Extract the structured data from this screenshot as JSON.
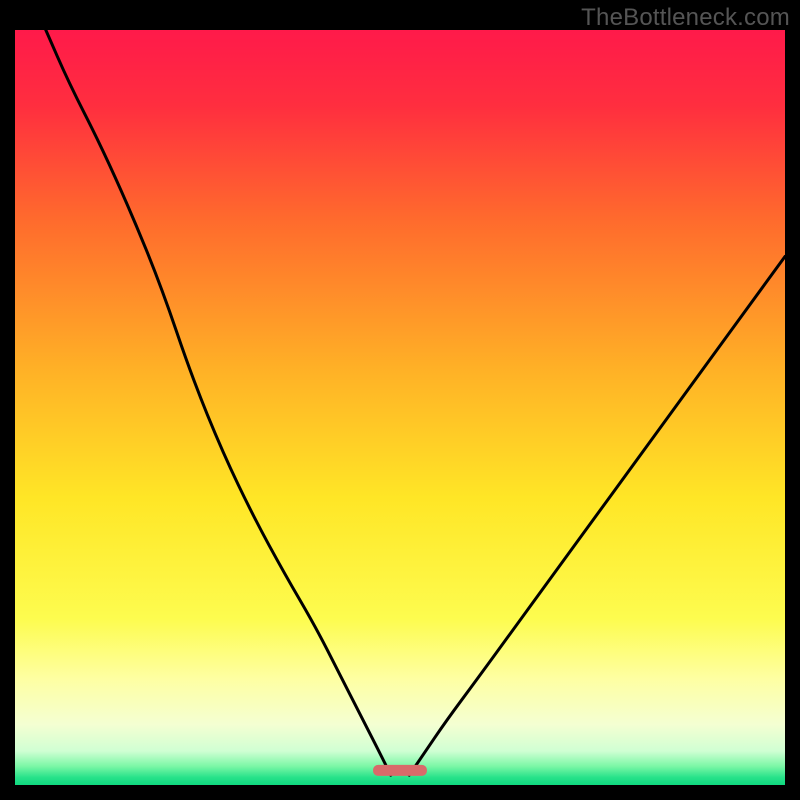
{
  "watermark": "TheBottleneck.com",
  "chart_data": {
    "type": "line",
    "title": "",
    "xlabel": "",
    "ylabel": "",
    "xlim": [
      0,
      100
    ],
    "ylim": [
      0,
      100
    ],
    "background_gradient": {
      "stops": [
        {
          "offset": 0.0,
          "color": "#ff1a4a"
        },
        {
          "offset": 0.1,
          "color": "#ff2e3f"
        },
        {
          "offset": 0.25,
          "color": "#ff6a2d"
        },
        {
          "offset": 0.45,
          "color": "#ffb126"
        },
        {
          "offset": 0.62,
          "color": "#ffe626"
        },
        {
          "offset": 0.78,
          "color": "#fdfc4f"
        },
        {
          "offset": 0.86,
          "color": "#feffa3"
        },
        {
          "offset": 0.92,
          "color": "#f4ffd2"
        },
        {
          "offset": 0.955,
          "color": "#d0ffd3"
        },
        {
          "offset": 0.975,
          "color": "#7cf7a6"
        },
        {
          "offset": 0.99,
          "color": "#27e28a"
        },
        {
          "offset": 1.0,
          "color": "#0fd87f"
        }
      ]
    },
    "marker": {
      "x_center": 50,
      "width": 7,
      "y": 2,
      "color": "#d86a6a"
    },
    "series": [
      {
        "name": "left-curve",
        "x": [
          4.0,
          7,
          11,
          15,
          19,
          23,
          27,
          31,
          35,
          39,
          42,
          45,
          47.5,
          48.8
        ],
        "values": [
          100,
          93,
          85,
          76,
          66,
          54,
          44,
          35.5,
          28,
          21,
          15,
          9,
          4,
          1.3
        ]
      },
      {
        "name": "right-curve",
        "x": [
          51.2,
          53,
          56,
          60,
          65,
          70,
          75,
          80,
          85,
          90,
          95,
          100
        ],
        "values": [
          1.3,
          4,
          8.5,
          14,
          21,
          28,
          35,
          42,
          49,
          56,
          63,
          70
        ]
      }
    ]
  }
}
